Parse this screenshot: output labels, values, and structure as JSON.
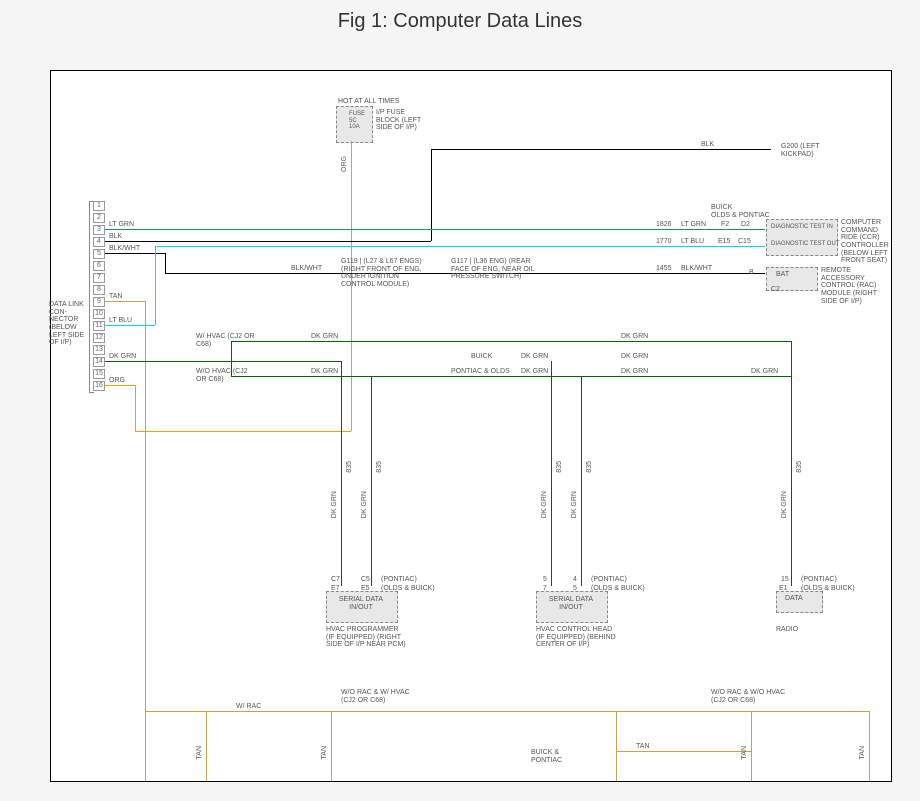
{
  "title": "Fig 1: Computer Data Lines",
  "fuse_block": {
    "label": "FUSE\n5C\n10A",
    "desc": "I/P FUSE BLOCK (LEFT SIDE OF I/P)",
    "hot": "HOT AT ALL TIMES"
  },
  "g200": "G200 (LEFT KICKPAD)",
  "blk": "BLK",
  "dlc": {
    "label": "DATA LINK CON-NECTOR (BELOW LEFT SIDE OF I/P)",
    "pins": {
      "p1": "1",
      "p2": "2",
      "p3": "3",
      "p4": "4",
      "p5": "5",
      "p6": "6",
      "p7": "7",
      "p8": "8",
      "p9": "9",
      "p10": "10",
      "p11": "11",
      "p12": "12",
      "p13": "13",
      "p14": "14",
      "p15": "15",
      "p16": "16"
    }
  },
  "wires": {
    "ltgrn": "LT GRN",
    "blk": "BLK",
    "blkwht": "BLK/WHT",
    "tan": "TAN",
    "ltblu": "LT BLU",
    "dkgrn": "DK GRN",
    "org": "ORG"
  },
  "splice": {
    "g119": "G119 | (L27 & L67 ENGS) (RIGHT FRONT OF ENG, UNDER IGNITION CONTROL MODULE)",
    "g117": "G117 | (L36 ENG) (REAR FACE OF ENG, NEAR OIL PRESSURE SWITCH)"
  },
  "ccr": {
    "buick": "BUICK",
    "olds": "OLDS & PONTIAC",
    "test_in": "DIAGNOSTIC TEST IN",
    "test_out": "DIAGNOSTIC TEST OUT",
    "desc": "COMPUTER COMMAND RIDE (CCR) CONTROLLER (BELOW LEFT FRONT SEAT)"
  },
  "rac": {
    "bat": "BAT",
    "desc": "REMOTE ACCESSORY CONTROL (RAC) MODULE (RIGHT SIDE OF I/P)"
  },
  "codes": {
    "c1826": "1826",
    "c1770": "1770",
    "c1455": "1455",
    "c835": "835"
  },
  "pins_right": {
    "f2": "F2",
    "d2": "D2",
    "e15": "E15",
    "c15": "C15",
    "b": "B",
    "c2": "C2"
  },
  "hvac": {
    "with": "W/ HVAC (CJ2 OR C68)",
    "without": "W/O HVAC (CJ2 OR C68)",
    "buick": "BUICK",
    "pontiac_olds": "PONTIAC & OLDS",
    "pontiac": "(PONTIAC)",
    "olds_buick": "(OLDS & BUICK)"
  },
  "modules": {
    "serial": "SERIAL DATA IN/OUT",
    "hvac_prog": "HVAC PROGRAMMER (IF EQUIPPED) (RIGHT SIDE OF I/P NEAR PCM)",
    "hvac_head": "HVAC CONTROL HEAD (IF EQUIPPED) (BEHIND CENTER OF I/P)",
    "data": "DATA",
    "radio": "RADIO"
  },
  "mod_pins": {
    "c7": "C7",
    "e7": "E7",
    "c5": "C5",
    "e5": "E5",
    "p5a": "5",
    "p7": "7",
    "p4": "4",
    "p5b": "5",
    "p15": "15",
    "e1": "E1"
  },
  "bottom": {
    "wrac": "W/ RAC",
    "wo_rac_w_hvac": "W/O RAC & W/ HVAC (CJ2 OR C68)",
    "wo_rac_wo_hvac": "W/O RAC & W/O HVAC (CJ2 OR C68)",
    "buick_pontiac": "BUICK & PONTIAC"
  }
}
